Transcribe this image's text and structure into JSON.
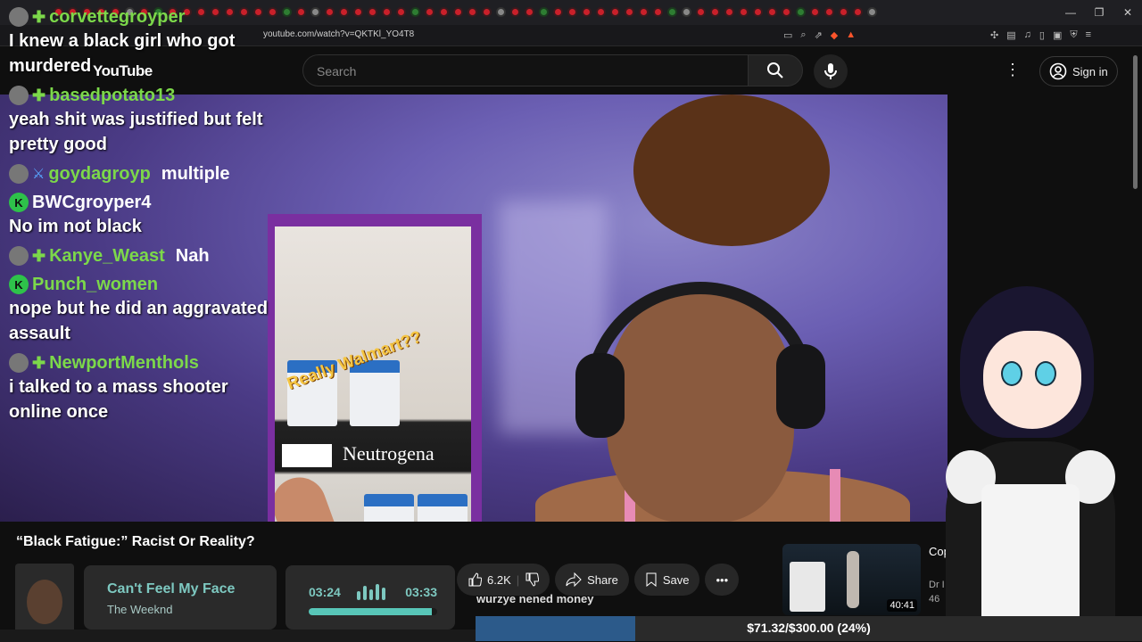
{
  "browser": {
    "url": "youtube.com/watch?v=QKTKl_YO4T8"
  },
  "header": {
    "logo": "YouTube",
    "search_placeholder": "Search",
    "signin_label": "Sign in",
    "icons": [
      "search-icon",
      "mic-icon",
      "more-vert-icon",
      "account-circle-icon"
    ]
  },
  "chat": {
    "messages": [
      {
        "user": "corvettegroyper",
        "text": "I knew a black girl who got murdered",
        "badge": "plus"
      },
      {
        "user": "basedpotato13",
        "text": "yeah shit was justified but felt pretty good",
        "badge": "plus"
      },
      {
        "user": "goydagroyp",
        "text": "multiple",
        "badge": "sword",
        "inline": true
      },
      {
        "user": "BWCgroyper4",
        "text": "No im not black",
        "badge": "k",
        "white": true
      },
      {
        "user": "Kanye_Weast",
        "text": "Nah",
        "badge": "plus",
        "inline": true
      },
      {
        "user": "Punch_women",
        "text": "nope but he did an aggravated assault",
        "badge": "k"
      },
      {
        "user": "NewportMenthols",
        "text": "i talked to a mass shooter online once",
        "badge": "plus"
      }
    ]
  },
  "video": {
    "insert_caption": "Really Walmart??",
    "insert_brand": "Neutrogena",
    "title": "“Black Fatigue:” Racist Or Reality?"
  },
  "now_playing": {
    "song": "Can't Feel My Face",
    "artist": "The Weeknd",
    "current": "03:24",
    "duration": "03:33",
    "progress": 0.96
  },
  "actions": {
    "likes": "6.2K",
    "share": "Share",
    "save": "Save"
  },
  "superchat": "wurzye nened money",
  "goal": {
    "text": "$71.32/$300.00 (24%)",
    "fraction": 0.24
  },
  "recommended": {
    "title": "Cop Dun Bo",
    "channel": "Dr I",
    "meta": "46",
    "duration": "40:41"
  },
  "colors": {
    "chat_user": "#7cd84a",
    "accent_teal": "#7dc8c0",
    "goal_fill": "#2c5a8a"
  }
}
